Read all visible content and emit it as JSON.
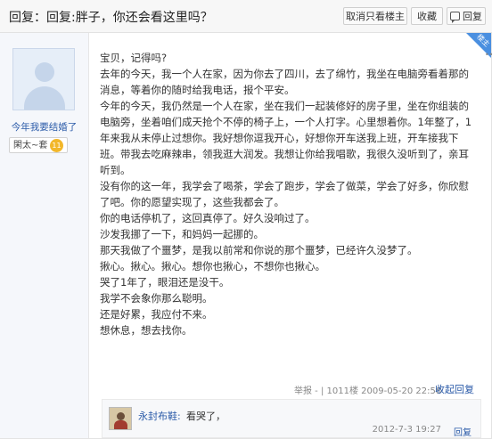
{
  "header": {
    "title": "回复：回复:胖子，你还会看这里吗？",
    "only_op_label": "取消只看楼主",
    "favorite_label": "收藏",
    "reply_label": "回复"
  },
  "author": {
    "name": "今年我要结婚了",
    "badge_label": "閑太~套",
    "level": "11",
    "floor_tag": "楼主"
  },
  "post": {
    "lines": [
      "宝贝，记得吗?",
      "去年的今天，我一个人在家，因为你去了四川，去了绵竹，我坐在电脑旁看着那的消息，等着你的随时给我电话，报个平安。",
      "今年的今天，我仍然是一个人在家，坐在我们一起装修好的房子里，坐在你组装的电脑旁，坐着咱们成天抢个不停的椅子上，一个人打字。心里想着你。1年整了，1年来我从未停止过想你。我好想你逗我开心，好想你开车送我上班，开车接我下班。带我去吃麻辣串，领我逛大润发。我想让你给我唱歌，我很久没听到了，亲耳听到。",
      "没有你的这一年，我学会了喝茶，学会了跑步，学会了做菜，学会了好多，你欣慰了吧。你的愿望实现了，这些我都会了。",
      "你的电话停机了，这回真停了。好久没响过了。",
      "沙发我挪了一下，和妈妈一起挪的。",
      "那天我做了个噩梦，是我以前常和你说的那个噩梦，已经许久没梦了。",
      "揪心。揪心。揪心。想你也揪心，不想你也揪心。",
      "哭了1年了，眼泪还是没干。",
      "我学不会象你那么聪明。",
      "还是好累，我应付不来。",
      "想休息，想去找你。"
    ],
    "meta": "举报 - | 1011楼 2009-05-20 22:58",
    "collapse_reply_label": "收起回复"
  },
  "reply": {
    "user": "永封布鞋:",
    "text": "看哭了，",
    "time": "2012-7-3 19:27",
    "reply_label": "回复"
  }
}
